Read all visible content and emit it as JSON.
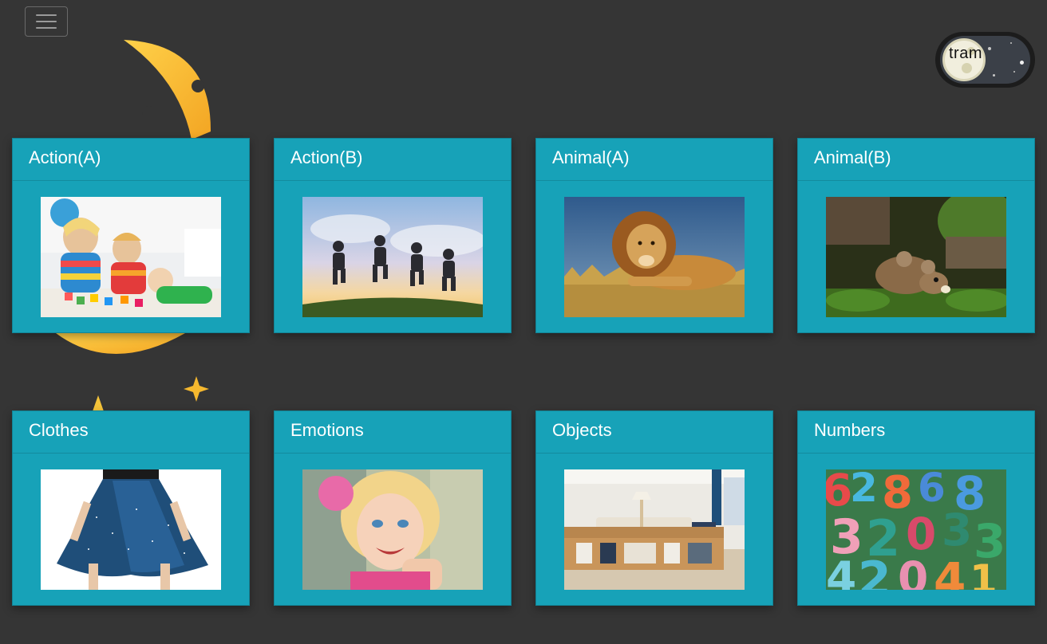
{
  "navbar": {
    "menu_icon": "hamburger-menu-icon"
  },
  "theme_toggle": {
    "label": "tram",
    "mode": "night",
    "icon": "moon-icon"
  },
  "decoration": {
    "icon": "crescent-moon-with-stars",
    "colors": [
      "#f5b82e",
      "#ffd45a"
    ]
  },
  "colors": {
    "background": "#353535",
    "card": "#17a2b8",
    "card_text": "#ffffff"
  },
  "categories": [
    {
      "title": "Action(A)",
      "image": "children-playing-with-toy-blocks"
    },
    {
      "title": "Action(B)",
      "image": "kids-jumping-at-sunset"
    },
    {
      "title": "Animal(A)",
      "image": "lion-lying-in-grass"
    },
    {
      "title": "Animal(B)",
      "image": "mouse-in-grass"
    },
    {
      "title": "Clothes",
      "image": "blue-sparkly-skirt"
    },
    {
      "title": "Emotions",
      "image": "smiling-girl"
    },
    {
      "title": "Objects",
      "image": "living-room-with-bookshelf"
    },
    {
      "title": "Numbers",
      "image": "colorful-wooden-numbers"
    }
  ]
}
